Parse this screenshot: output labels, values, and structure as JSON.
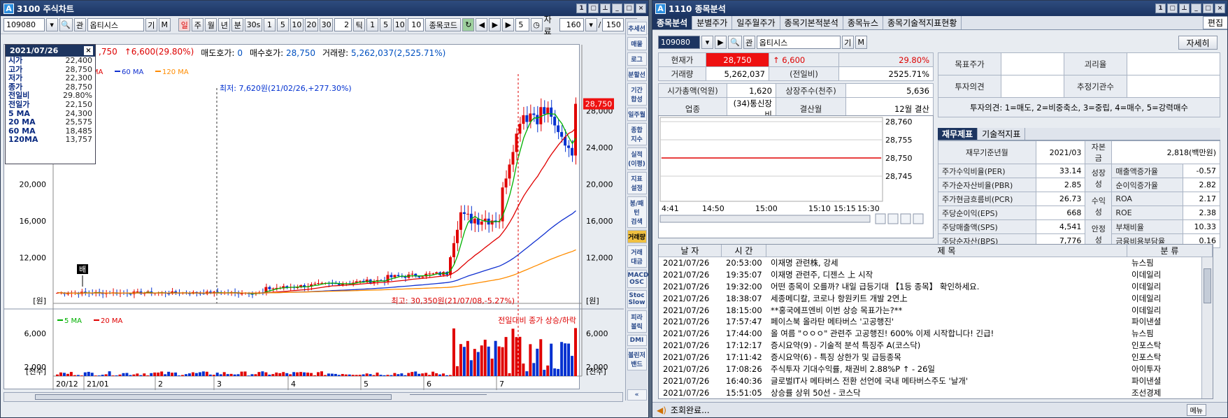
{
  "left_window": {
    "title": "3100 주식차트",
    "code": "109080",
    "name": "옵티시스",
    "btn_gi": "기",
    "btn_m": "M",
    "btn_kwan": "관",
    "periods": [
      "일",
      "주",
      "월",
      "년",
      "분",
      "30s",
      "1",
      "5",
      "10",
      "20",
      "30"
    ],
    "tick_value": "2",
    "tick_label": "틱",
    "tick_opts": [
      "1",
      "5",
      "10"
    ],
    "tick_count": "10",
    "code_search_label": "종목코드",
    "count5": "5",
    "data_label": "자료",
    "data_count": "160",
    "slash": "/",
    "total": "150",
    "dang": "당",
    "info_bar": {
      "price_partial": ",750",
      "change": "6,600(29.80%)",
      "sell_label": "매도호가:",
      "sell_val": "0",
      "buy_label": "매수호가:",
      "buy_val": "28,750",
      "volume_label": "거래량:",
      "volume_val": "5,262,037(2,525.71%)"
    },
    "ma_legend": [
      "20 MA",
      "60 MA",
      "120 MA"
    ],
    "ma_legend_colors": [
      "#e00000",
      "#1030d0",
      "#ff8c00"
    ],
    "vol_legend": [
      "5 MA",
      "20 MA"
    ],
    "vol_legend_colors": [
      "#00b000",
      "#e00000"
    ],
    "vol_title": "전일대비 종가 상승/하락",
    "min_annot": "최저: 7,620원(21/02/26,+277.30%)",
    "max_annot": "최고: 30,350원(21/07/08,-5.27%)",
    "bae_label": "배",
    "price_tag": "28,750",
    "unit_won": "[원]",
    "unit_thousand": "[천주]",
    "left_axis": [
      "20,000",
      "16,000",
      "12,000"
    ],
    "right_axis": [
      "28,000",
      "24,000",
      "20,000",
      "16,000",
      "12,000"
    ],
    "vol_axis": [
      "6,000",
      "2,000"
    ],
    "x_labels": [
      "20/12",
      "21/01",
      "2",
      "3",
      "4",
      "5",
      "6",
      "7"
    ],
    "side_buttons": [
      "추세선",
      "매물",
      "로그",
      "분할선",
      "기간\n합성",
      "일주월",
      "종합\n지수",
      "실적\n(이평)",
      "지표\n설정",
      "봉/패턴\n검색",
      "거래량",
      "거래\n대금",
      "MACD\nOSC",
      "Stoc\nSlow",
      "피라\n볼릭",
      "DMI",
      "볼린저\n밴드"
    ],
    "collapse": "«",
    "popup": {
      "date": "2021/07/26",
      "rows": [
        [
          "시가",
          "22,400"
        ],
        [
          "고가",
          "28,750"
        ],
        [
          "저가",
          "22,300"
        ],
        [
          "종가",
          "28,750"
        ],
        [
          "전일비",
          "29.80%"
        ],
        [
          "전일가",
          "22,150"
        ],
        [
          "5  MA",
          "24,300"
        ],
        [
          "20 MA",
          "25,575"
        ],
        [
          "60 MA",
          "18,485"
        ],
        [
          "120MA",
          "13,757"
        ]
      ]
    }
  },
  "chart_data": {
    "type": "line",
    "title": "",
    "x": [
      "20/12",
      "21/01",
      "2",
      "3",
      "4",
      "5",
      "6",
      "7"
    ],
    "series": [
      {
        "name": "종가",
        "values": [
          8000,
          8300,
          8100,
          8600,
          9400,
          9800,
          16800,
          28750
        ]
      },
      {
        "name": "20 MA",
        "values": [
          8200,
          8250,
          8200,
          8500,
          9200,
          9600,
          15000,
          25575
        ]
      },
      {
        "name": "60 MA",
        "values": [
          8300,
          8300,
          8250,
          8300,
          8700,
          9100,
          11500,
          18485
        ]
      },
      {
        "name": "120 MA",
        "values": [
          8400,
          8350,
          8300,
          8300,
          8500,
          8800,
          10200,
          13757
        ]
      }
    ],
    "ylim": [
      7000,
      31000
    ],
    "current_price": 28750
  },
  "right_window": {
    "title": "1110 종목분석",
    "tabs": [
      "종목분석",
      "분별주가",
      "일주월주가",
      "종목기본적분석",
      "종목뉴스",
      "종목기술적지표현황"
    ],
    "edit": "편집",
    "code": "109080",
    "name": "옵티시스",
    "btn_gi": "기",
    "btn_m": "M",
    "btn_kwan": "관",
    "detail_btn": "자세히",
    "quote": {
      "price_label": "현재가",
      "price": "28,750",
      "change": "6,600",
      "pct": "29.80%",
      "vol_label": "거래량",
      "vol": "5,262,037",
      "prev_label": "(전일비)",
      "prev": "2525.71%",
      "mcap_label": "시가총액(억원)",
      "mcap": "1,620",
      "shares_label": "상장주수(천주)",
      "shares": "5,636",
      "sector_label": "업종",
      "sector": "(34)통신장비",
      "fiscal_label": "결산월",
      "fiscal": "12월 결산"
    },
    "target": {
      "target_label": "목표주가",
      "gap_label": "괴리율",
      "opinion_label": "투자의견",
      "est_label": "추정기관수",
      "legend": "투자의견: 1=매도, 2=비중축소, 3=중립, 4=매수, 5=강력매수"
    },
    "intraday": {
      "yticks": [
        "28,760",
        "28,755",
        "28,750",
        "28,745"
      ],
      "xticks": [
        "4:41",
        "14:50",
        "15:00",
        "15:10",
        "15:15",
        "15:30"
      ]
    },
    "fin_tabs": [
      "재무제표",
      "기술적지표"
    ],
    "fin": {
      "base_label": "재무기준년월",
      "base": "2021/03",
      "capital_label": "자본금",
      "capital": "2,818(백만원)",
      "rows": [
        [
          "주가수익비율(PER)",
          "33.14",
          "성장성",
          "매출액증가율",
          "-0.57"
        ],
        [
          "주가순자산비율(PBR)",
          "2.85",
          "",
          "순이익증가율",
          "2.82"
        ],
        [
          "주가현금흐름비(PCR)",
          "26.73",
          "수익성",
          "ROA",
          "2.17"
        ],
        [
          "주당순이익(EPS)",
          "668",
          "",
          "ROE",
          "2.38"
        ],
        [
          "주당매출액(SPS)",
          "4,541",
          "안정성",
          "부채비율",
          "10.33"
        ],
        [
          "주당순자산(BPS)",
          "7,776",
          "",
          "금융비용부담율",
          "0.16"
        ]
      ]
    },
    "news_headers": [
      "날 자",
      "시 간",
      "제                목",
      "분 류"
    ],
    "news": [
      [
        "2021/07/26",
        "20:53:00",
        "이재명 관련株, 강세",
        "뉴스핌"
      ],
      [
        "2021/07/26",
        "19:35:07",
        "이재명 관련주, 디젠스 上 시작",
        "이데일리"
      ],
      [
        "2021/07/26",
        "19:32:00",
        "어떤 종목이 오를까? 내일 급등기대 【1등 종목】 확인하세요.",
        "이데일리"
      ],
      [
        "2021/07/26",
        "18:38:07",
        "세종메디칼, 코로나 항원키트 개발 2연上",
        "이데일리"
      ],
      [
        "2021/07/26",
        "18:15:00",
        "**홍국에프엔비 이번 상승 목표가는?**",
        "이데일리"
      ],
      [
        "2021/07/26",
        "17:57:47",
        "페이스북 올라탄 메타버스 '고공행진'",
        "파이낸셜"
      ],
      [
        "2021/07/26",
        "17:44:00",
        "올 여름 \"ㅇㅇㅇ\" 관련주 고공행진! 600% 이제 시작합니다! 긴급!",
        "뉴스핌"
      ],
      [
        "2021/07/26",
        "17:12:17",
        "증시요약(9) - 기술적 분석 특징주 A(코스닥)",
        "인포스탁"
      ],
      [
        "2021/07/26",
        "17:11:42",
        "증시요약(6) - 특징 상한가 및 급등종목",
        "인포스탁"
      ],
      [
        "2021/07/26",
        "17:08:26",
        "주식투자 기대수익률, 채권비 2.88%P ↑ - 26일",
        "아이투자"
      ],
      [
        "2021/07/26",
        "16:40:36",
        "글로벌IT사 메타버스 전환 선언에 국내 메타버스주도 '날개'",
        "파이낸셜"
      ],
      [
        "2021/07/26",
        "15:51:05",
        "상승률 상위 50선 - 코스닥",
        "조선경제"
      ]
    ],
    "status": "조회완료...",
    "menu": "메뉴"
  }
}
